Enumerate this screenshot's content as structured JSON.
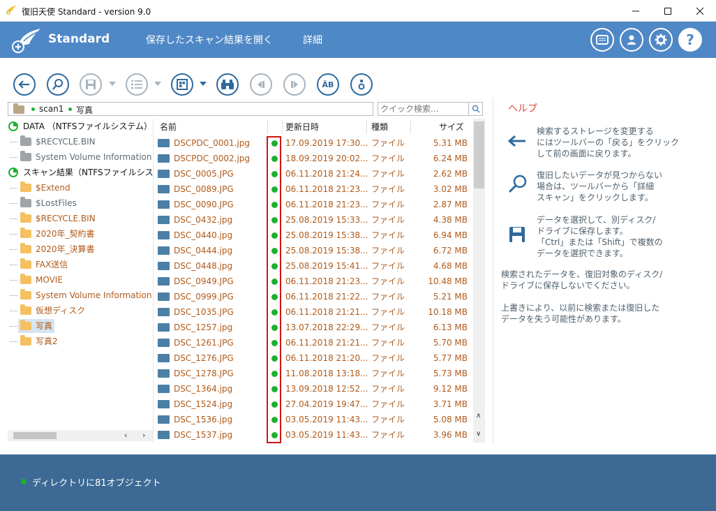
{
  "window": {
    "title": "復旧天使 Standard - version 9.0"
  },
  "banner": {
    "brand": "Standard",
    "menu": [
      "保存したスキャン結果を開く",
      "詳細"
    ]
  },
  "path": {
    "segments": [
      "scan1",
      "写真"
    ]
  },
  "search": {
    "placeholder": "クイック検索..."
  },
  "tree": [
    {
      "label": "DATA （NTFSファイルシステム）",
      "type": "root",
      "indent": 0
    },
    {
      "label": "$RECYCLE.BIN",
      "type": "gray",
      "indent": 1
    },
    {
      "label": "System Volume Information",
      "type": "gray",
      "indent": 1
    },
    {
      "label": "スキャン結果（NTFSファイルシス",
      "type": "root",
      "indent": 0
    },
    {
      "label": "$Extend",
      "type": "found",
      "indent": 1
    },
    {
      "label": "$LostFiles",
      "type": "gray",
      "indent": 1
    },
    {
      "label": "$RECYCLE.BIN",
      "type": "found",
      "indent": 1
    },
    {
      "label": "2020年_契約書",
      "type": "found",
      "indent": 1
    },
    {
      "label": "2020年_決算書",
      "type": "found",
      "indent": 1
    },
    {
      "label": "FAX送信",
      "type": "found",
      "indent": 1
    },
    {
      "label": "MOVIE",
      "type": "found",
      "indent": 1
    },
    {
      "label": "System Volume Information",
      "type": "found",
      "indent": 1
    },
    {
      "label": "仮想ディスク",
      "type": "found",
      "indent": 1
    },
    {
      "label": "写真",
      "type": "selected",
      "indent": 1
    },
    {
      "label": "写真2",
      "type": "found",
      "indent": 1
    }
  ],
  "columns": {
    "name": "名前",
    "date": "更新日時",
    "type": "種類",
    "size": "サイズ"
  },
  "files": [
    {
      "name": "DSCPDC_0001.jpg",
      "date": "17.09.2019 17:30...",
      "type": "ファイル",
      "size": "5.31 MB"
    },
    {
      "name": "DSCPDC_0002.jpg",
      "date": "18.09.2019 20:02...",
      "type": "ファイル",
      "size": "6.24 MB"
    },
    {
      "name": "DSC_0005.JPG",
      "date": "06.11.2018 21:24...",
      "type": "ファイル",
      "size": "2.62 MB"
    },
    {
      "name": "DSC_0089.JPG",
      "date": "06.11.2018 21:23...",
      "type": "ファイル",
      "size": "3.02 MB"
    },
    {
      "name": "DSC_0090.JPG",
      "date": "06.11.2018 21:23...",
      "type": "ファイル",
      "size": "2.87 MB"
    },
    {
      "name": "DSC_0432.jpg",
      "date": "25.08.2019 15:33...",
      "type": "ファイル",
      "size": "4.38 MB"
    },
    {
      "name": "DSC_0440.jpg",
      "date": "25.08.2019 15:38...",
      "type": "ファイル",
      "size": "6.94 MB"
    },
    {
      "name": "DSC_0444.jpg",
      "date": "25.08.2019 15:38...",
      "type": "ファイル",
      "size": "6.72 MB"
    },
    {
      "name": "DSC_0448.jpg",
      "date": "25.08.2019 15:41...",
      "type": "ファイル",
      "size": "4.68 MB"
    },
    {
      "name": "DSC_0949.JPG",
      "date": "06.11.2018 21:23...",
      "type": "ファイル",
      "size": "10.48 MB"
    },
    {
      "name": "DSC_0999.JPG",
      "date": "06.11.2018 21:22...",
      "type": "ファイル",
      "size": "5.21 MB"
    },
    {
      "name": "DSC_1035.JPG",
      "date": "06.11.2018 21:21...",
      "type": "ファイル",
      "size": "10.18 MB"
    },
    {
      "name": "DSC_1257.jpg",
      "date": "13.07.2018 22:29...",
      "type": "ファイル",
      "size": "6.13 MB"
    },
    {
      "name": "DSC_1261.JPG",
      "date": "06.11.2018 21:21...",
      "type": "ファイル",
      "size": "5.70 MB"
    },
    {
      "name": "DSC_1276.JPG",
      "date": "06.11.2018 21:20...",
      "type": "ファイル",
      "size": "5.77 MB"
    },
    {
      "name": "DSC_1278.JPG",
      "date": "11.08.2018 13:18...",
      "type": "ファイル",
      "size": "5.73 MB"
    },
    {
      "name": "DSC_1364.jpg",
      "date": "13.09.2018 12:52...",
      "type": "ファイル",
      "size": "9.12 MB"
    },
    {
      "name": "DSC_1524.jpg",
      "date": "27.04.2019 19:47...",
      "type": "ファイル",
      "size": "3.71 MB"
    },
    {
      "name": "DSC_1536.jpg",
      "date": "03.05.2019 11:43...",
      "type": "ファイル",
      "size": "5.08 MB"
    },
    {
      "name": "DSC_1537.jpg",
      "date": "03.05.2019 11:43...",
      "type": "ファイル",
      "size": "3.96 MB"
    }
  ],
  "help": {
    "title": "ヘルプ",
    "tips": [
      {
        "icon": "back-arrow-icon",
        "lines": [
          "検索するストレージを変更する",
          "にはツールバーの「戻る」をクリック",
          "して前の画面に戻ります。"
        ]
      },
      {
        "icon": "search-icon",
        "lines": [
          "復旧したいデータが見つからない",
          "場合は、ツールバーから「詳細",
          "スキャン」をクリックします。"
        ]
      },
      {
        "icon": "save-icon",
        "lines": [
          "データを選択して、別ディスク/",
          "ドライブに保存します。",
          "「Ctrl」または「Shift」で複数の",
          "データを選択できます。"
        ]
      }
    ],
    "notes": [
      [
        "検索されたデータを、復旧対象のディスク/",
        "ドライブに保存しないでください。"
      ],
      [
        "上書きにより、以前に検索または復旧した",
        "データを失う可能性があります。"
      ]
    ]
  },
  "status": {
    "text": "ディレクトリに81オブジェクト"
  },
  "colors": {
    "banner": "#4f88c6",
    "accent": "#2e6a9e",
    "file_text": "#b05a1a",
    "status_dot": "#1cb033",
    "highlight": "#d01414",
    "statusbar": "#3d6a95"
  }
}
